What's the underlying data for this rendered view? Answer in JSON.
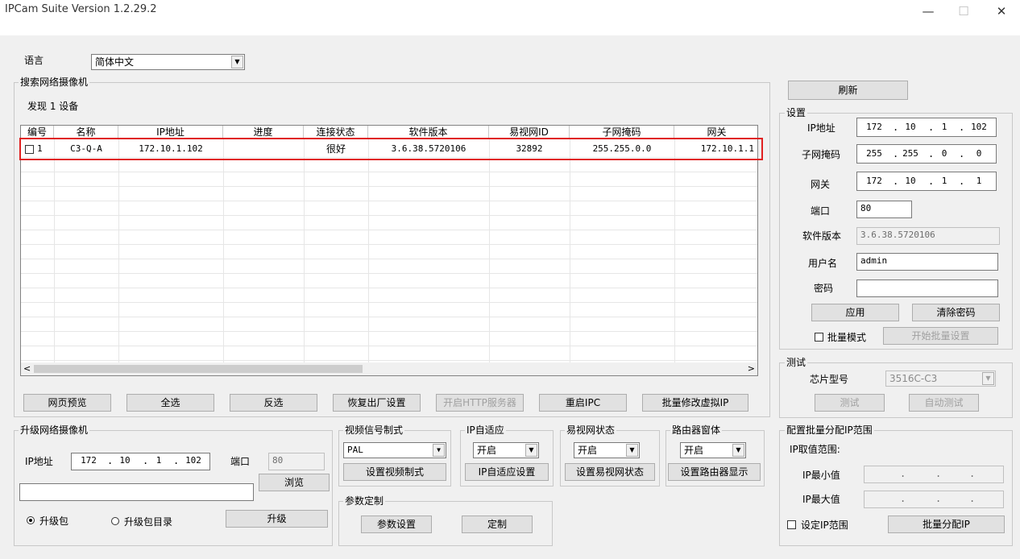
{
  "window": {
    "title": "IPCam Suite Version 1.2.29.2",
    "min": "—",
    "max": "☐",
    "close": "✕"
  },
  "language": {
    "label": "语言",
    "value": "简体中文"
  },
  "search": {
    "title": "搜索网络摄像机",
    "found": "发现 1 设备",
    "columns": [
      "编号",
      "名称",
      "IP地址",
      "进度",
      "连接状态",
      "软件版本",
      "易视网ID",
      "子网掩码",
      "网关"
    ],
    "rows": [
      {
        "no": "1",
        "name": "C3-Q-A",
        "ip": "172.10.1.102",
        "progress": "",
        "status": "很好",
        "version": "3.6.38.5720106",
        "id": "32892",
        "mask": "255.255.0.0",
        "gateway": "172.10.1.1"
      }
    ],
    "buttons": [
      "网页预览",
      "全选",
      "反选",
      "恢复出厂设置",
      "开启HTTP服务器",
      "重启IPC",
      "批量修改虚拟IP"
    ]
  },
  "refresh": "刷新",
  "settings": {
    "title": "设置",
    "ip_label": "IP地址",
    "ip": [
      "172",
      "10",
      "1",
      "102"
    ],
    "mask_label": "子网掩码",
    "mask": [
      "255",
      "255",
      "0",
      "0"
    ],
    "gw_label": "网关",
    "gw": [
      "172",
      "10",
      "1",
      "1"
    ],
    "port_label": "端口",
    "port": "80",
    "version_label": "软件版本",
    "version": "3.6.38.5720106",
    "user_label": "用户名",
    "user": "admin",
    "pwd_label": "密码",
    "pwd": "",
    "apply": "应用",
    "clear_pwd": "清除密码",
    "batch_mode": "批量模式",
    "start_batch": "开始批量设置"
  },
  "test": {
    "title": "测试",
    "chip_label": "芯片型号",
    "chip": "3516C-C3",
    "test_btn": "测试",
    "auto_test": "自动测试"
  },
  "upgrade": {
    "title": "升级网络摄像机",
    "ip_label": "IP地址",
    "ip": [
      "172",
      "10",
      "1",
      "102"
    ],
    "port_label": "端口",
    "port": "80",
    "path": "",
    "browse": "浏览",
    "opt_pkg": "升级包",
    "opt_dir": "升级包目录",
    "upgrade_btn": "升级"
  },
  "video": {
    "title": "视频信号制式",
    "value": "PAL",
    "btn": "设置视频制式"
  },
  "ipauto": {
    "title": "IP自适应",
    "value": "开启",
    "btn": "IP自适应设置"
  },
  "yishi": {
    "title": "易视网状态",
    "value": "开启",
    "btn": "设置易视网状态"
  },
  "router": {
    "title": "路由器窗体",
    "value": "开启",
    "btn": "设置路由器显示"
  },
  "params": {
    "title": "参数定制",
    "set": "参数设置",
    "custom": "定制"
  },
  "batch_ip": {
    "title": "配置批量分配IP范围",
    "range_label": "IP取值范围:",
    "min_label": "IP最小值",
    "max_label": "IP最大值",
    "set_range": "设定IP范围",
    "assign": "批量分配IP"
  },
  "colors": {
    "highlight": "#e02020"
  }
}
